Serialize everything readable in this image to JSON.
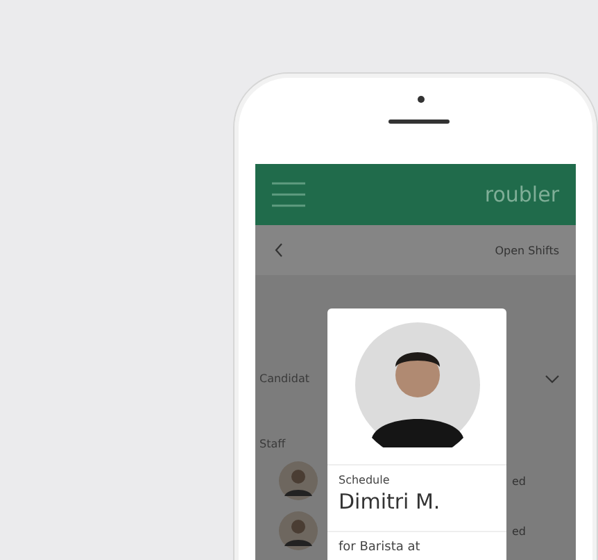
{
  "app_bar": {
    "logo": "roubler"
  },
  "nav": {
    "title": "Open Shifts"
  },
  "candidates": {
    "label": "Candidat"
  },
  "staff": {
    "label": "Staff",
    "members": [
      {
        "status": "ed"
      },
      {
        "status": "ed"
      }
    ]
  },
  "card": {
    "caption": "Schedule",
    "name": "Dimitri M.",
    "detail": "for Barista at"
  }
}
